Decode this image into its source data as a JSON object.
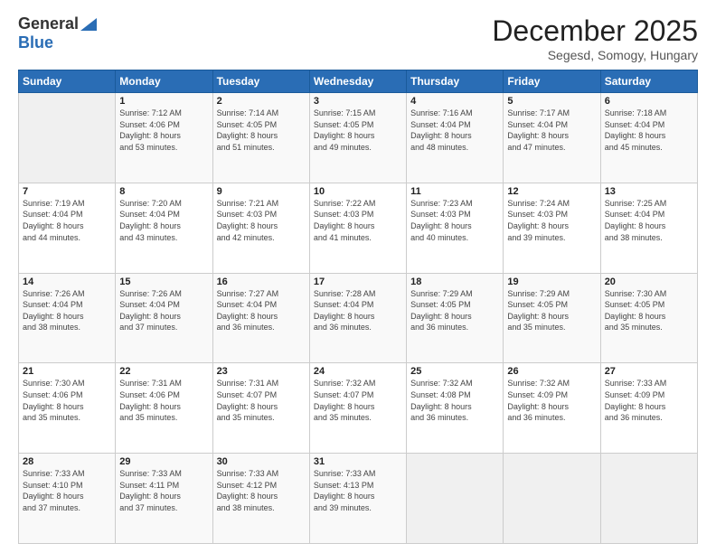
{
  "logo": {
    "general": "General",
    "blue": "Blue"
  },
  "title": "December 2025",
  "location": "Segesd, Somogy, Hungary",
  "weekdays": [
    "Sunday",
    "Monday",
    "Tuesday",
    "Wednesday",
    "Thursday",
    "Friday",
    "Saturday"
  ],
  "weeks": [
    [
      {
        "day": "",
        "sunrise": "",
        "sunset": "",
        "daylight": ""
      },
      {
        "day": "1",
        "sunrise": "Sunrise: 7:12 AM",
        "sunset": "Sunset: 4:06 PM",
        "daylight": "Daylight: 8 hours and 53 minutes."
      },
      {
        "day": "2",
        "sunrise": "Sunrise: 7:14 AM",
        "sunset": "Sunset: 4:05 PM",
        "daylight": "Daylight: 8 hours and 51 minutes."
      },
      {
        "day": "3",
        "sunrise": "Sunrise: 7:15 AM",
        "sunset": "Sunset: 4:05 PM",
        "daylight": "Daylight: 8 hours and 49 minutes."
      },
      {
        "day": "4",
        "sunrise": "Sunrise: 7:16 AM",
        "sunset": "Sunset: 4:04 PM",
        "daylight": "Daylight: 8 hours and 48 minutes."
      },
      {
        "day": "5",
        "sunrise": "Sunrise: 7:17 AM",
        "sunset": "Sunset: 4:04 PM",
        "daylight": "Daylight: 8 hours and 47 minutes."
      },
      {
        "day": "6",
        "sunrise": "Sunrise: 7:18 AM",
        "sunset": "Sunset: 4:04 PM",
        "daylight": "Daylight: 8 hours and 45 minutes."
      }
    ],
    [
      {
        "day": "7",
        "sunrise": "Sunrise: 7:19 AM",
        "sunset": "Sunset: 4:04 PM",
        "daylight": "Daylight: 8 hours and 44 minutes."
      },
      {
        "day": "8",
        "sunrise": "Sunrise: 7:20 AM",
        "sunset": "Sunset: 4:04 PM",
        "daylight": "Daylight: 8 hours and 43 minutes."
      },
      {
        "day": "9",
        "sunrise": "Sunrise: 7:21 AM",
        "sunset": "Sunset: 4:03 PM",
        "daylight": "Daylight: 8 hours and 42 minutes."
      },
      {
        "day": "10",
        "sunrise": "Sunrise: 7:22 AM",
        "sunset": "Sunset: 4:03 PM",
        "daylight": "Daylight: 8 hours and 41 minutes."
      },
      {
        "day": "11",
        "sunrise": "Sunrise: 7:23 AM",
        "sunset": "Sunset: 4:03 PM",
        "daylight": "Daylight: 8 hours and 40 minutes."
      },
      {
        "day": "12",
        "sunrise": "Sunrise: 7:24 AM",
        "sunset": "Sunset: 4:03 PM",
        "daylight": "Daylight: 8 hours and 39 minutes."
      },
      {
        "day": "13",
        "sunrise": "Sunrise: 7:25 AM",
        "sunset": "Sunset: 4:04 PM",
        "daylight": "Daylight: 8 hours and 38 minutes."
      }
    ],
    [
      {
        "day": "14",
        "sunrise": "Sunrise: 7:26 AM",
        "sunset": "Sunset: 4:04 PM",
        "daylight": "Daylight: 8 hours and 38 minutes."
      },
      {
        "day": "15",
        "sunrise": "Sunrise: 7:26 AM",
        "sunset": "Sunset: 4:04 PM",
        "daylight": "Daylight: 8 hours and 37 minutes."
      },
      {
        "day": "16",
        "sunrise": "Sunrise: 7:27 AM",
        "sunset": "Sunset: 4:04 PM",
        "daylight": "Daylight: 8 hours and 36 minutes."
      },
      {
        "day": "17",
        "sunrise": "Sunrise: 7:28 AM",
        "sunset": "Sunset: 4:04 PM",
        "daylight": "Daylight: 8 hours and 36 minutes."
      },
      {
        "day": "18",
        "sunrise": "Sunrise: 7:29 AM",
        "sunset": "Sunset: 4:05 PM",
        "daylight": "Daylight: 8 hours and 36 minutes."
      },
      {
        "day": "19",
        "sunrise": "Sunrise: 7:29 AM",
        "sunset": "Sunset: 4:05 PM",
        "daylight": "Daylight: 8 hours and 35 minutes."
      },
      {
        "day": "20",
        "sunrise": "Sunrise: 7:30 AM",
        "sunset": "Sunset: 4:05 PM",
        "daylight": "Daylight: 8 hours and 35 minutes."
      }
    ],
    [
      {
        "day": "21",
        "sunrise": "Sunrise: 7:30 AM",
        "sunset": "Sunset: 4:06 PM",
        "daylight": "Daylight: 8 hours and 35 minutes."
      },
      {
        "day": "22",
        "sunrise": "Sunrise: 7:31 AM",
        "sunset": "Sunset: 4:06 PM",
        "daylight": "Daylight: 8 hours and 35 minutes."
      },
      {
        "day": "23",
        "sunrise": "Sunrise: 7:31 AM",
        "sunset": "Sunset: 4:07 PM",
        "daylight": "Daylight: 8 hours and 35 minutes."
      },
      {
        "day": "24",
        "sunrise": "Sunrise: 7:32 AM",
        "sunset": "Sunset: 4:07 PM",
        "daylight": "Daylight: 8 hours and 35 minutes."
      },
      {
        "day": "25",
        "sunrise": "Sunrise: 7:32 AM",
        "sunset": "Sunset: 4:08 PM",
        "daylight": "Daylight: 8 hours and 36 minutes."
      },
      {
        "day": "26",
        "sunrise": "Sunrise: 7:32 AM",
        "sunset": "Sunset: 4:09 PM",
        "daylight": "Daylight: 8 hours and 36 minutes."
      },
      {
        "day": "27",
        "sunrise": "Sunrise: 7:33 AM",
        "sunset": "Sunset: 4:09 PM",
        "daylight": "Daylight: 8 hours and 36 minutes."
      }
    ],
    [
      {
        "day": "28",
        "sunrise": "Sunrise: 7:33 AM",
        "sunset": "Sunset: 4:10 PM",
        "daylight": "Daylight: 8 hours and 37 minutes."
      },
      {
        "day": "29",
        "sunrise": "Sunrise: 7:33 AM",
        "sunset": "Sunset: 4:11 PM",
        "daylight": "Daylight: 8 hours and 37 minutes."
      },
      {
        "day": "30",
        "sunrise": "Sunrise: 7:33 AM",
        "sunset": "Sunset: 4:12 PM",
        "daylight": "Daylight: 8 hours and 38 minutes."
      },
      {
        "day": "31",
        "sunrise": "Sunrise: 7:33 AM",
        "sunset": "Sunset: 4:13 PM",
        "daylight": "Daylight: 8 hours and 39 minutes."
      },
      {
        "day": "",
        "sunrise": "",
        "sunset": "",
        "daylight": ""
      },
      {
        "day": "",
        "sunrise": "",
        "sunset": "",
        "daylight": ""
      },
      {
        "day": "",
        "sunrise": "",
        "sunset": "",
        "daylight": ""
      }
    ]
  ]
}
